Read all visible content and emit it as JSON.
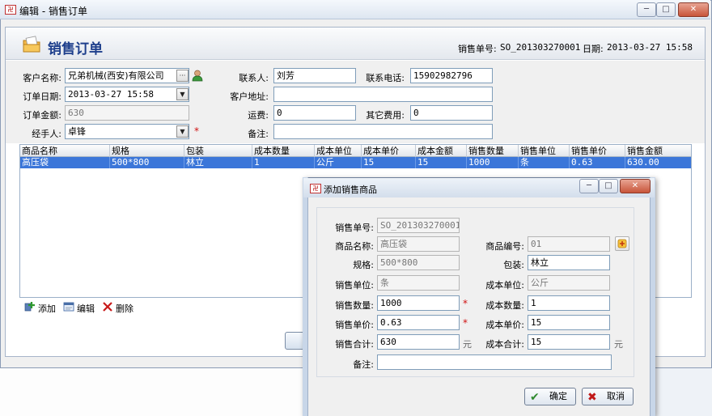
{
  "main_window": {
    "title": "编辑 - 销售订单",
    "controls": [
      "─",
      "□",
      "✕"
    ],
    "page_title": "销售订单",
    "order_no_label": "销售单号:",
    "order_no": "SO_201303270001",
    "date_label": "日期:",
    "date": "2013-03-27 15:58"
  },
  "form": {
    "customer_label": "客户名称:",
    "customer_value": "兄弟机械(西安)有限公司",
    "customer_btn": "···",
    "contact_label": "联系人:",
    "contact_value": "刘芳",
    "phone_label": "联系电话:",
    "phone_value": "15902982796",
    "order_date_label": "订单日期:",
    "order_date_value": "2013-03-27 15:58",
    "address_label": "客户地址:",
    "address_value": "",
    "amount_label": "订单金额:",
    "amount_value": "630",
    "freight_label": "运费:",
    "freight_value": "0",
    "other_fee_label": "其它费用:",
    "other_fee_value": "0",
    "handler_label": "经手人:",
    "handler_value": "卓锋",
    "remark_label": "备注:",
    "remark_value": "",
    "required_mark": "*"
  },
  "grid": {
    "columns": [
      "商品名称",
      "规格",
      "包装",
      "成本数量",
      "成本单位",
      "成本单价",
      "成本金额",
      "销售数量",
      "销售单位",
      "销售单价",
      "销售金额"
    ],
    "rows": [
      [
        "高压袋",
        "500*800",
        "林立",
        "1",
        "公斤",
        "15",
        "15",
        "1000",
        "条",
        "0.63",
        "630.00"
      ]
    ]
  },
  "toolbar": {
    "add": "添加",
    "edit": "编辑",
    "delete": "删除"
  },
  "dialog": {
    "title": "添加销售商品",
    "controls": [
      "─",
      "□",
      "✕"
    ],
    "order_no_label": "销售单号:",
    "order_no_value": "SO_201303270001",
    "product_name_label": "商品名称:",
    "product_name_value": "高压袋",
    "product_code_label": "商品编号:",
    "product_code_value": "01",
    "spec_label": "规格:",
    "spec_value": "500*800",
    "pack_label": "包装:",
    "pack_value": "林立",
    "sale_unit_label": "销售单位:",
    "sale_unit_value": "条",
    "cost_unit_label": "成本单位:",
    "cost_unit_value": "公斤",
    "sale_qty_label": "销售数量:",
    "sale_qty_value": "1000",
    "cost_qty_label": "成本数量:",
    "cost_qty_value": "1",
    "sale_price_label": "销售单价:",
    "sale_price_value": "0.63",
    "cost_price_label": "成本单价:",
    "cost_price_value": "15",
    "sale_total_label": "销售合计:",
    "sale_total_value": "630",
    "cost_total_label": "成本合计:",
    "cost_total_value": "15",
    "unit_yuan": "元",
    "remark_label": "备注:",
    "remark_value": "",
    "required_mark": "*",
    "ok_label": "确定",
    "cancel_label": "取消"
  },
  "colors": {
    "title_blue": "#1e3f8c",
    "selection_blue": "#3b76d9",
    "required_red": "#d01010"
  }
}
